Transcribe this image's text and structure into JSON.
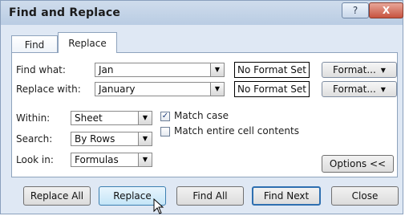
{
  "window": {
    "title": "Find and Replace",
    "help_label": "?",
    "close_label": "X"
  },
  "tabs": [
    {
      "label": "Find"
    },
    {
      "label": "Replace"
    }
  ],
  "find": {
    "label": "Find what:",
    "value": "Jan",
    "format_status": "No Format Set",
    "format_button": "Format..."
  },
  "replace": {
    "label": "Replace with:",
    "value": "January",
    "format_status": "No Format Set",
    "format_button": "Format..."
  },
  "options": {
    "within": {
      "label": "Within:",
      "value": "Sheet"
    },
    "search": {
      "label": "Search:",
      "value": "By Rows"
    },
    "look_in": {
      "label": "Look in:",
      "value": "Formulas"
    },
    "match_case": {
      "label": "Match case",
      "checked": true
    },
    "match_entire": {
      "label": "Match entire cell contents",
      "checked": false
    },
    "options_button": "Options <<"
  },
  "buttons": {
    "replace_all": "Replace All",
    "replace": "Replace",
    "find_all": "Find All",
    "find_next": "Find Next",
    "close": "Close"
  }
}
